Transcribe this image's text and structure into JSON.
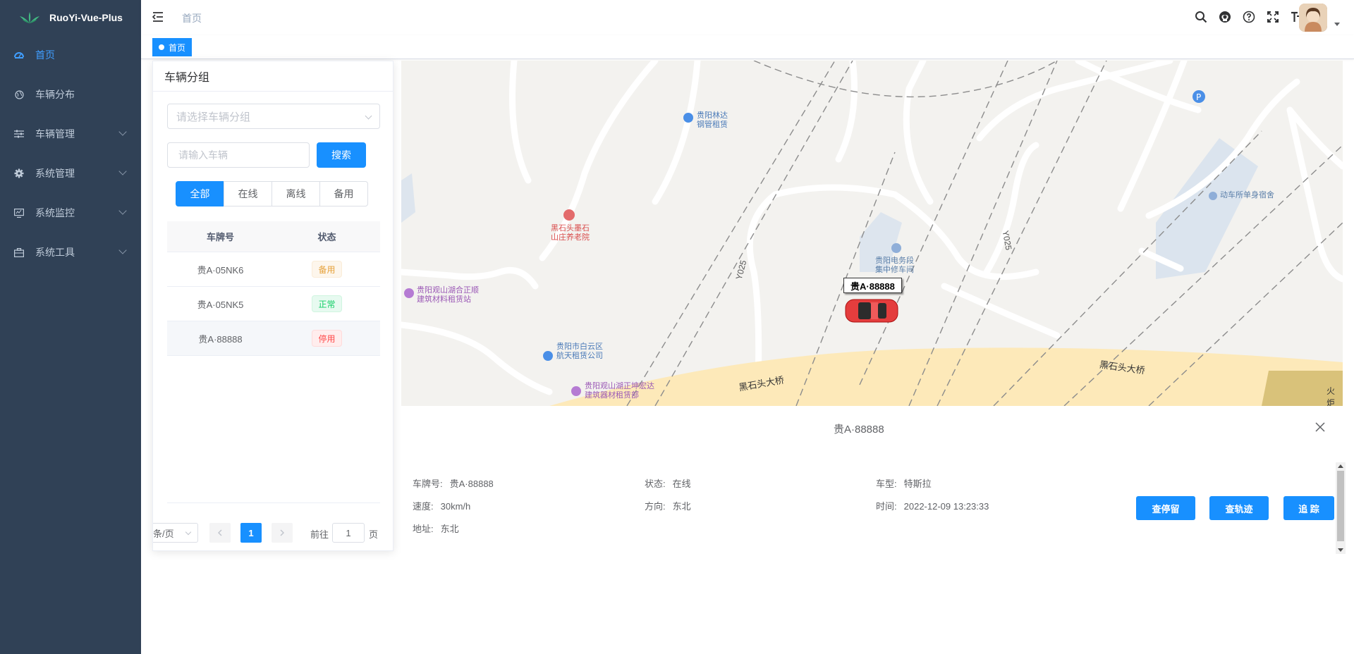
{
  "app": {
    "title": "RuoYi-Vue-Plus"
  },
  "sidebar": {
    "items": [
      {
        "label": "首页",
        "icon": "dashboard-icon",
        "active": true
      },
      {
        "label": "车辆分布",
        "icon": "globe-icon"
      },
      {
        "label": "车辆管理",
        "icon": "sliders-icon",
        "expandable": true
      },
      {
        "label": "系统管理",
        "icon": "gear-icon",
        "expandable": true
      },
      {
        "label": "系统监控",
        "icon": "monitor-icon",
        "expandable": true
      },
      {
        "label": "系统工具",
        "icon": "toolbox-icon",
        "expandable": true
      }
    ]
  },
  "navbar": {
    "breadcrumb": "首页",
    "icons": [
      "search-icon",
      "github-icon",
      "help-icon",
      "fullscreen-icon",
      "font-size-icon"
    ]
  },
  "tags": {
    "active": "首页"
  },
  "panel": {
    "title": "车辆分组",
    "group_placeholder": "请选择车辆分组",
    "car_placeholder": "请输入车辆",
    "search_label": "搜索",
    "filters": [
      "全部",
      "在线",
      "离线",
      "备用"
    ],
    "filter_selected": "全部",
    "columns": [
      "车牌号",
      "状态"
    ],
    "rows": [
      {
        "plate": "贵A·05NK6",
        "status": "备用",
        "type": "warning"
      },
      {
        "plate": "贵A·05NK5",
        "status": "正常",
        "type": "success"
      },
      {
        "plate": "贵A·88888",
        "status": "停用",
        "type": "danger"
      }
    ],
    "pager": {
      "size_text": "条/页",
      "current": "1",
      "goto_prefix": "前往",
      "goto_value": "1",
      "goto_suffix": "页"
    }
  },
  "map": {
    "car_label": "贵A·88888",
    "pois": [
      {
        "text": "贵阳林达\n钢管租赁"
      },
      {
        "text": "黑石头墨石\n山庄养老院"
      },
      {
        "text": "贵阳电务段\n集中修车间"
      },
      {
        "text": "贵阳观山湖合正顺\n建筑材料租赁站"
      },
      {
        "text": "贵阳市白云区\n航天租赁公司"
      },
      {
        "text": "贵阳观山湖正坤宏达\n建筑器材租赁部"
      },
      {
        "text": "动车所单身宿舍"
      }
    ],
    "roads": [
      "黑石头大桥",
      "黑石头大桥",
      "火炬"
    ],
    "road_codes": [
      "Y025",
      "Y025"
    ]
  },
  "detail": {
    "title": "贵A·88888",
    "fields": [
      {
        "k": "车牌号:",
        "v": "贵A·88888"
      },
      {
        "k": "状态:",
        "v": "在线"
      },
      {
        "k": "车型:",
        "v": "特斯拉"
      },
      {
        "k": "速度:",
        "v": "30km/h"
      },
      {
        "k": "方向:",
        "v": "东北"
      },
      {
        "k": "时间:",
        "v": "2022-12-09 13:23:33"
      },
      {
        "k": "地址:",
        "v": "东北"
      }
    ],
    "actions": [
      "查停留",
      "查轨迹",
      "追 踪"
    ]
  },
  "colors": {
    "primary": "#1890ff",
    "sidebar": "#304156"
  }
}
